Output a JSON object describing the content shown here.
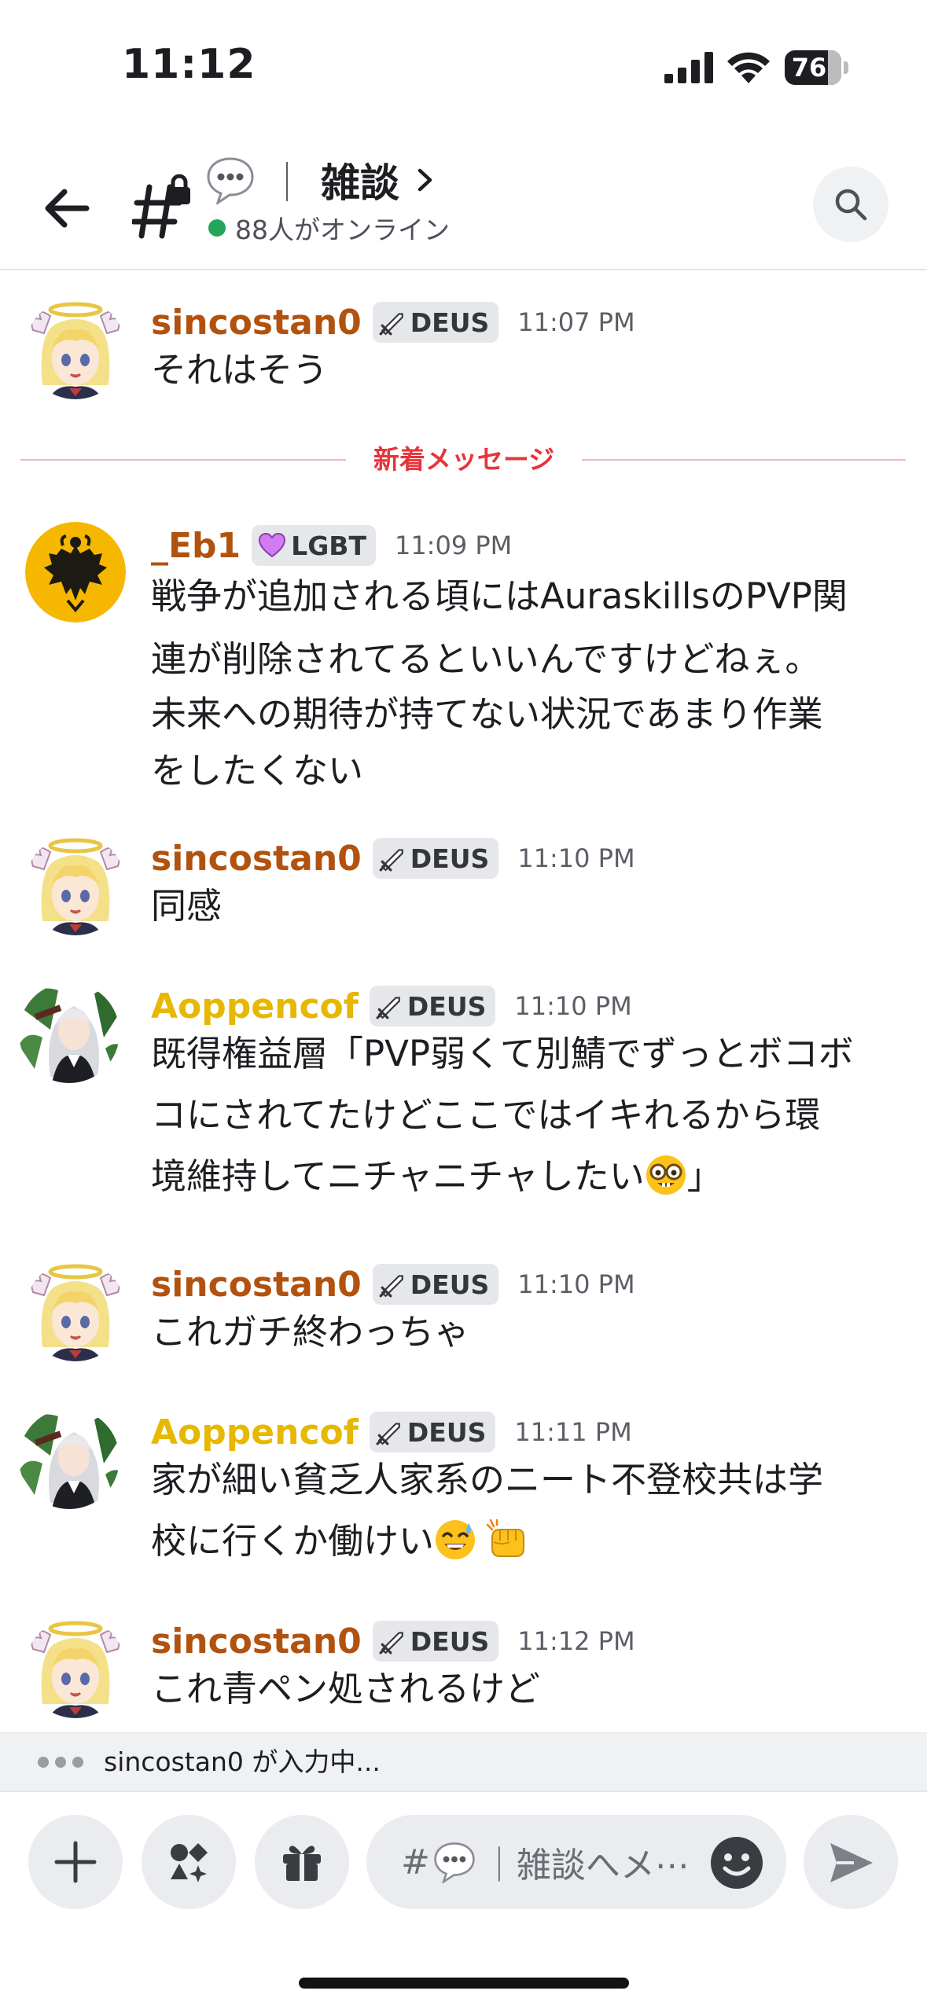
{
  "status_bar": {
    "time": "11:12",
    "battery_level": "76",
    "battery_fraction": 0.76
  },
  "header": {
    "channel_emoji": "speech-bubble-icon",
    "channel_separator": "｜",
    "channel_name": "雑談",
    "online_text": "88人がオンライン"
  },
  "colors": {
    "online": "#23a55a",
    "sincostan0": "#b2520f",
    "_Eb1": "#b2520f",
    "Aoppencof": "#e6b800",
    "new_messages": "#e5353b"
  },
  "messages": [
    {
      "author": "sincostan0",
      "badge_icon": "crossed-swords-icon",
      "badge": "DEUS",
      "time": "11:07 PM",
      "text": "それはそう"
    },
    {
      "author": "_Eb1",
      "badge_icon": "purple-heart-icon",
      "badge": "LGBT",
      "time": "11:09 PM",
      "text_lines": [
        "戦争が追加される頃にはAuraskillsのPVP関",
        "連が削除されてるといいんですけどねぇ。",
        "未来への期待が持てない状況であまり作業",
        "をしたくない"
      ]
    },
    {
      "author": "sincostan0",
      "badge_icon": "crossed-swords-icon",
      "badge": "DEUS",
      "time": "11:10 PM",
      "text": "同感"
    },
    {
      "author": "Aoppencof",
      "badge_icon": "crossed-swords-icon",
      "badge": "DEUS",
      "time": "11:10 PM",
      "text_lines": [
        "既得権益層「PVP弱くて別鯖でずっとボコボ",
        "コにされてたけどここではイキれるから環",
        "境維持してニチャニチャしたい"
      ],
      "text_end": "」",
      "emojis": [
        "nerd-face-icon"
      ]
    },
    {
      "author": "sincostan0",
      "badge_icon": "crossed-swords-icon",
      "badge": "DEUS",
      "time": "11:10 PM",
      "text": "これガチ終わっちゃ"
    },
    {
      "author": "Aoppencof",
      "badge_icon": "crossed-swords-icon",
      "badge": "DEUS",
      "time": "11:11 PM",
      "text_lines": [
        "家が細い貧乏人家系のニート不登校共は学",
        "校に行くか働けい"
      ],
      "emojis": [
        "sweat-smile-icon",
        "fist-bump-icon"
      ]
    },
    {
      "author": "sincostan0",
      "badge_icon": "crossed-swords-icon",
      "badge": "DEUS",
      "time": "11:12 PM",
      "text": "これ青ペン処されるけど"
    }
  ],
  "new_messages_label": "新着メッセージ",
  "typing": {
    "text": "sincostan0 が入力中..."
  },
  "composer": {
    "placeholder_prefix": "#",
    "placeholder_rest": "｜雑談へメ⋯"
  }
}
